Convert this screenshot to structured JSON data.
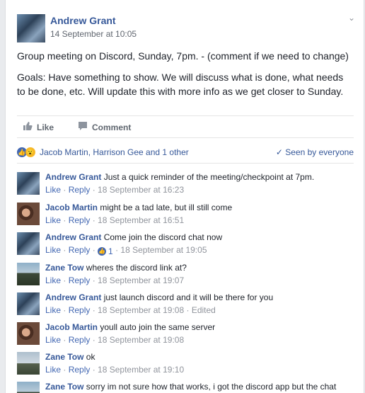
{
  "post": {
    "author": "Andrew Grant",
    "timestamp": "14 September at 10:05",
    "paragraph1": "Group meeting on Discord, Sunday, 7pm. - (comment if we need to change)",
    "paragraph2": "Goals: Have something to show. We will discuss what is done, what needs to be done, etc. Will update this with more info as we get closer to Sunday.",
    "like_label": "Like",
    "comment_label": "Comment",
    "reactions_text": "Jacob Martin, Harrison Gee and 1 other",
    "seen_text": "Seen by everyone"
  },
  "comments": [
    {
      "name": "Andrew Grant",
      "text": "Just a quick reminder of the meeting/checkpoint at 7pm.",
      "like": "Like",
      "reply": "Reply",
      "time": "18 September at 16:23",
      "likes": "",
      "edited": ""
    },
    {
      "name": "Jacob Martin",
      "text": "might be a tad late, but ill still come",
      "like": "Like",
      "reply": "Reply",
      "time": "18 September at 16:51",
      "likes": "",
      "edited": ""
    },
    {
      "name": "Andrew Grant",
      "text": "Come join the discord chat now",
      "like": "Like",
      "reply": "Reply",
      "time": "18 September at 19:05",
      "likes": "1",
      "edited": ""
    },
    {
      "name": "Zane Tow",
      "text": "wheres the discord link at?",
      "like": "Like",
      "reply": "Reply",
      "time": "18 September at 19:07",
      "likes": "",
      "edited": ""
    },
    {
      "name": "Andrew Grant",
      "text": "just launch discord and it will be there for you",
      "like": "Like",
      "reply": "Reply",
      "time": "18 September at 19:08",
      "likes": "",
      "edited": "Edited"
    },
    {
      "name": "Jacob Martin",
      "text": "youll auto join the same server",
      "like": "Like",
      "reply": "Reply",
      "time": "18 September at 19:08",
      "likes": "",
      "edited": ""
    },
    {
      "name": "Zane Tow",
      "text": "ok",
      "like": "Like",
      "reply": "Reply",
      "time": "18 September at 19:10",
      "likes": "",
      "edited": ""
    },
    {
      "name": "Zane Tow",
      "text": "sorry im not sure how that works, i got the discord app but the chat",
      "like": "",
      "reply": "",
      "time": "",
      "likes": "",
      "edited": ""
    }
  ]
}
